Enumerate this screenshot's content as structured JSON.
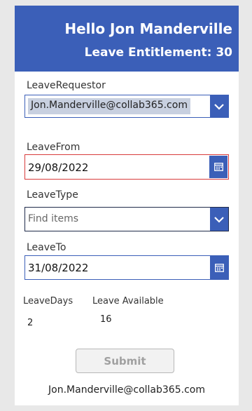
{
  "header": {
    "greeting": "Hello Jon Manderville",
    "entitlement": "Leave Entitlement: 30"
  },
  "leave_requestor": {
    "label": "LeaveRequestor",
    "value": "Jon.Manderville@collab365.com"
  },
  "leave_from": {
    "label": "LeaveFrom",
    "value": "29/08/2022"
  },
  "leave_type": {
    "label": "LeaveType",
    "placeholder": "Find items"
  },
  "leave_to": {
    "label": "LeaveTo",
    "value": "31/08/2022"
  },
  "leave_days": {
    "label": "LeaveDays",
    "value": "2"
  },
  "leave_available": {
    "label": "Leave Available",
    "value": "16"
  },
  "submit_label": "Submit",
  "footer_email": "Jon.Manderville@collab365.com",
  "colors": {
    "accent": "#3b5fb8",
    "error_border": "#d83b3b"
  },
  "icons": {
    "dropdown": "chevron-down-icon",
    "calendar": "calendar-icon"
  }
}
